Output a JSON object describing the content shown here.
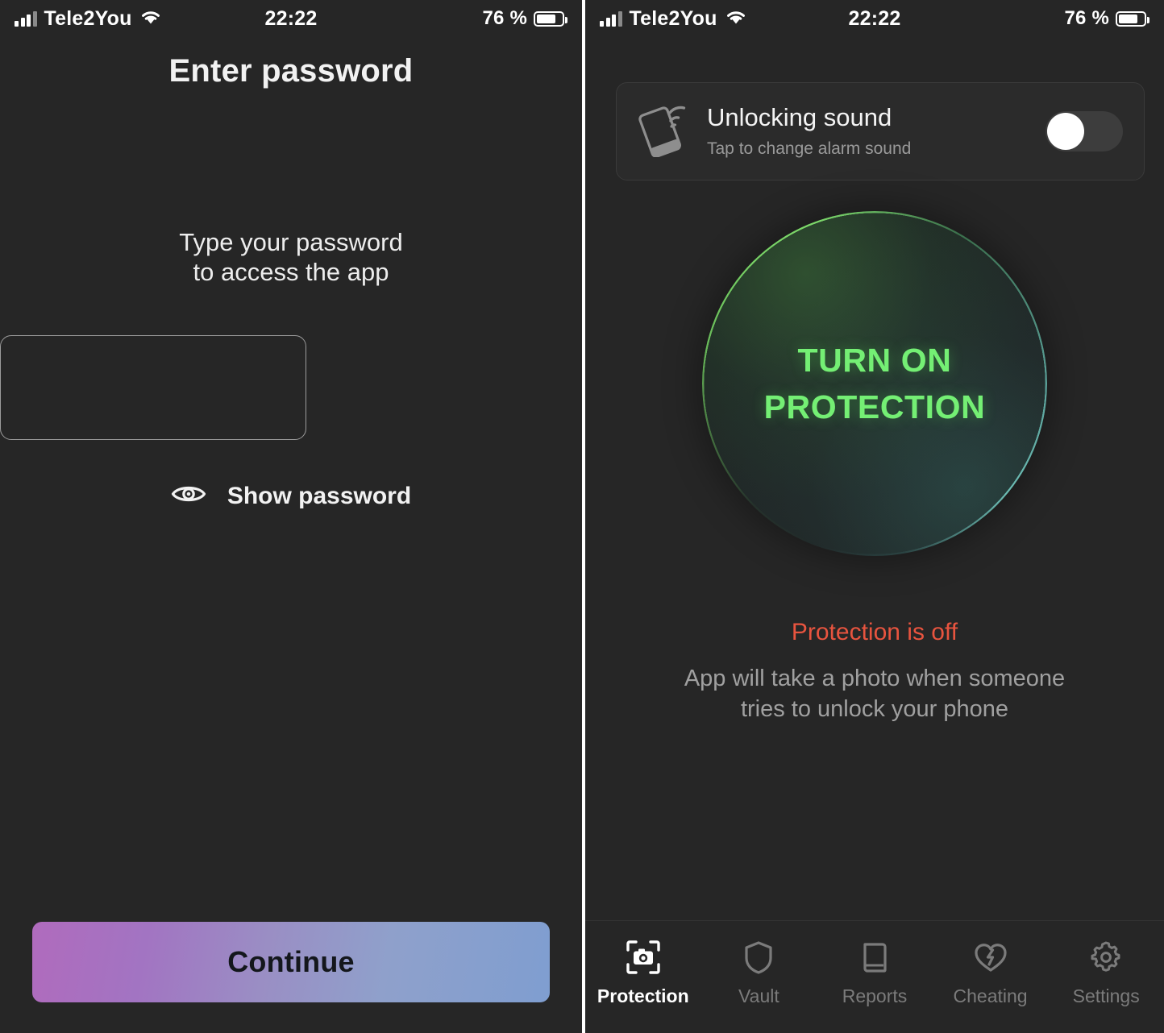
{
  "statusbar": {
    "carrier": "Tele2You",
    "time": "22:22",
    "battery_pct": "76 %",
    "icons": {
      "signal": "signal-bars-icon",
      "wifi": "wifi-icon",
      "battery": "battery-icon"
    }
  },
  "left_screen": {
    "title": "Enter password",
    "prompt_line1": "Type your password",
    "prompt_line2": "to access the app",
    "password_value": "",
    "password_placeholder": "",
    "show_password_label": "Show password",
    "show_password_icon": "eye-icon",
    "continue_label": "Continue",
    "continue_gradient_from": "#b06bbd",
    "continue_gradient_to": "#7f9ed0",
    "continue_text_color": "#14171c"
  },
  "right_screen": {
    "sound_card": {
      "icon": "phone-ringing-icon",
      "title": "Unlocking sound",
      "subtitle": "Tap to change alarm sound",
      "toggle_state": "off"
    },
    "protection_button": {
      "line1": "TURN ON",
      "line2": "PROTECTION",
      "text_color": "#74ef74"
    },
    "status_text": "Protection is off",
    "status_color": "#e8543f",
    "description_line1": "App will take a photo when someone",
    "description_line2": "tries to unlock your phone",
    "tabs": [
      {
        "label": "Protection",
        "icon": "camera-scan-icon",
        "active": true
      },
      {
        "label": "Vault",
        "icon": "shield-icon",
        "active": false
      },
      {
        "label": "Reports",
        "icon": "book-icon",
        "active": false
      },
      {
        "label": "Cheating",
        "icon": "broken-heart-icon",
        "active": false
      },
      {
        "label": "Settings",
        "icon": "gear-icon",
        "active": false
      }
    ]
  }
}
